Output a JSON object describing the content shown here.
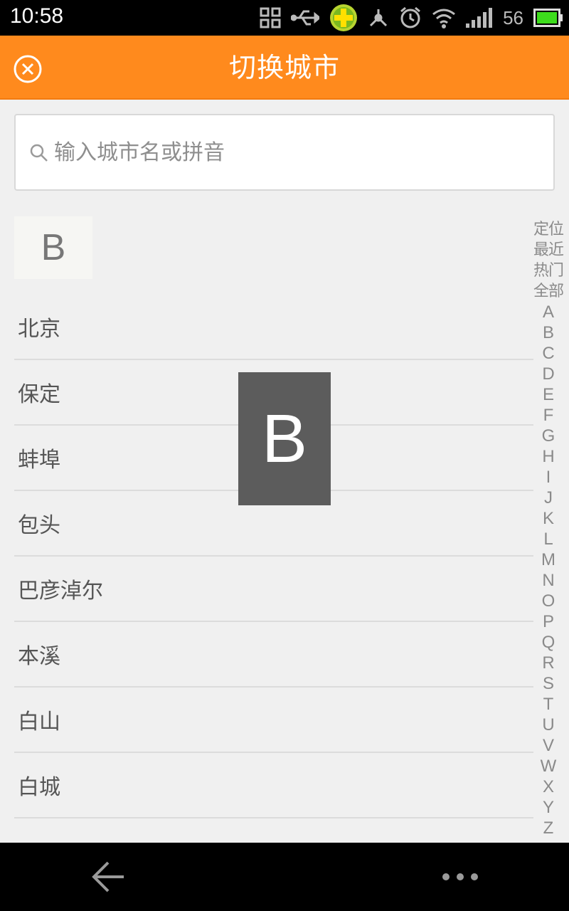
{
  "status_bar": {
    "time": "10:58",
    "battery_level": "56",
    "icons": [
      "qr-code-icon",
      "usb-icon",
      "security-app-icon",
      "network-share-icon",
      "alarm-icon",
      "wifi-icon",
      "signal-icon",
      "battery-icon"
    ]
  },
  "header": {
    "title": "切换城市",
    "close_icon": "close-circle-icon",
    "accent_color": "#ff8a1d"
  },
  "search": {
    "value": "",
    "placeholder": "输入城市名或拼音"
  },
  "list": {
    "section_header": "B",
    "cities": [
      "北京",
      "保定",
      "蚌埠",
      "包头",
      "巴彦淖尔",
      "本溪",
      "白山",
      "白城"
    ]
  },
  "overlay": {
    "letter": "B"
  },
  "index": {
    "items": [
      "定位",
      "最近",
      "热门",
      "全部",
      "A",
      "B",
      "C",
      "D",
      "E",
      "F",
      "G",
      "H",
      "I",
      "J",
      "K",
      "L",
      "M",
      "N",
      "O",
      "P",
      "Q",
      "R",
      "S",
      "T",
      "U",
      "V",
      "W",
      "X",
      "Y",
      "Z"
    ]
  },
  "nav": {
    "back_icon": "back-arrow-icon",
    "more_icon": "more-dots-icon"
  }
}
